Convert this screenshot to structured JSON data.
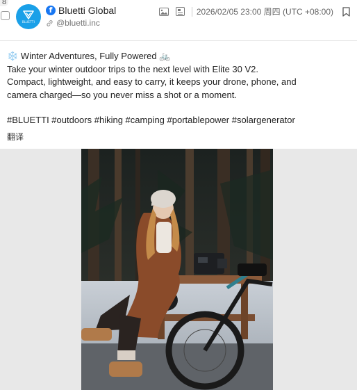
{
  "corner_count": "8",
  "account": {
    "name": "Bluetti Global",
    "handle": "@bluetti.inc",
    "platform_icon": "facebook-icon",
    "avatar_text": "BLUETTI"
  },
  "meta": {
    "timestamp": "2026/02/05 23:00 周四 (UTC +08:00)",
    "icons": [
      "image-icon",
      "document-icon",
      "bookmark-icon"
    ]
  },
  "post": {
    "title_line": "❄️ Winter Adventures, Fully Powered 🚲",
    "body_line1": "Take your winter outdoor trips to the next level with Elite 30 V2.",
    "body_line2": "Compact, lightweight, and easy to carry, it keeps your drone, phone, and",
    "body_line3": "camera charged—so you never miss a shot or a moment.",
    "hashtags": "#BLUETTI #outdoors #hiking #camping #portablepower #solargenerator",
    "translate_label": "翻译"
  },
  "colors": {
    "avatar_bg": "#1aa0e8",
    "facebook_blue": "#1877f2",
    "media_bg": "#e8e8e8"
  }
}
